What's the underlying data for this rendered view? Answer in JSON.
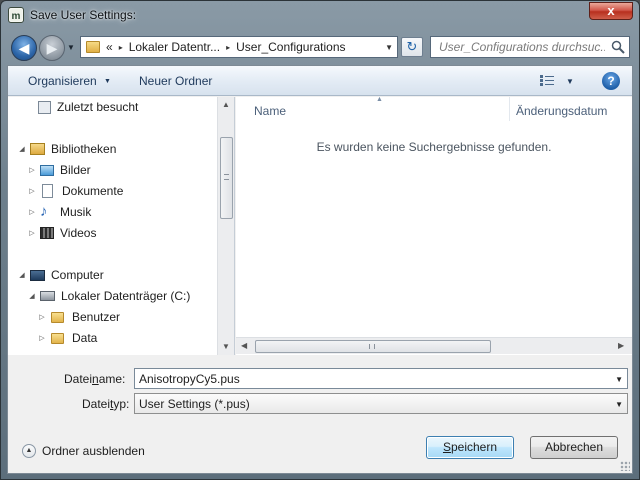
{
  "window": {
    "title": "Save User Settings:",
    "close_label": "x"
  },
  "address": {
    "overflow": "«",
    "parts": [
      "Lokaler Datentr...",
      "User_Configurations"
    ],
    "separator": "▸"
  },
  "search": {
    "placeholder": "User_Configurations durchsuc..."
  },
  "toolbar": {
    "organize_label": "Organisieren",
    "new_folder_label": "Neuer Ordner",
    "help_label": "?"
  },
  "nav": {
    "items": [
      {
        "label": "Zuletzt besucht",
        "icon": "recent-places-icon"
      },
      {
        "label": "Bibliotheken",
        "icon": "libraries-icon"
      },
      {
        "label": "Bilder",
        "icon": "pictures-icon"
      },
      {
        "label": "Dokumente",
        "icon": "documents-icon"
      },
      {
        "label": "Musik",
        "icon": "music-icon"
      },
      {
        "label": "Videos",
        "icon": "videos-icon"
      },
      {
        "label": "Computer",
        "icon": "computer-icon"
      },
      {
        "label": "Lokaler Datenträger (C:)",
        "icon": "drive-icon"
      },
      {
        "label": "Benutzer",
        "icon": "folder-icon"
      },
      {
        "label": "Data",
        "icon": "folder-icon"
      }
    ]
  },
  "filelist": {
    "columns": [
      "Name",
      "Änderungsdatum"
    ],
    "empty_message": "Es wurden keine Suchergebnisse gefunden."
  },
  "form": {
    "filename_label_pre": "Datei",
    "filename_label_ul": "n",
    "filename_label_post": "ame:",
    "filename_value": "AnisotropyCy5.pus",
    "filetype_label_pre": "Datei",
    "filetype_label_ul": "t",
    "filetype_label_post": "yp:",
    "filetype_value": "User Settings (*.pus)"
  },
  "footer": {
    "hide_folders_label": "Ordner ausblenden",
    "save_label_ul": "S",
    "save_label_rest": "peichern",
    "cancel_label": "Abbrechen"
  },
  "colors": {
    "accent": "#3c7fb1",
    "toolbar_text": "#1e395b",
    "close_red": "#c9473a"
  }
}
